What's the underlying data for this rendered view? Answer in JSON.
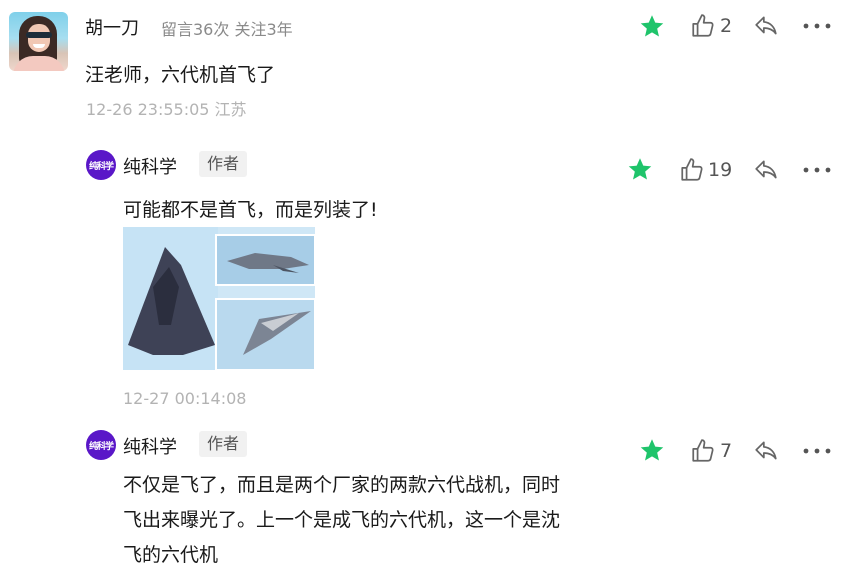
{
  "comments": [
    {
      "user": "胡一刀",
      "meta": "留言36次 关注3年",
      "text": "汪老师，六代机首飞了",
      "time": "12-26 23:55:05 江苏",
      "likes": "2"
    },
    {
      "user": "纯科学",
      "badge": "作者",
      "avatar_text": "纯科学",
      "text": "可能都不是首飞，而是列装了!",
      "time": "12-27 00:14:08",
      "likes": "19"
    },
    {
      "user": "纯科学",
      "badge": "作者",
      "avatar_text": "纯科学",
      "text_lines": [
        "不仅是飞了，而且是两个厂家的两款六代战机，同时",
        "飞出来曝光了。上一个是成飞的六代机，这一个是沈",
        "飞的六代机"
      ],
      "likes": "7"
    }
  ],
  "colors": {
    "star": "#1fc46b",
    "avatar_brand": "#5a17c8"
  },
  "icons": [
    "star-icon",
    "thumbs-up-icon",
    "reply-icon",
    "more-icon"
  ]
}
